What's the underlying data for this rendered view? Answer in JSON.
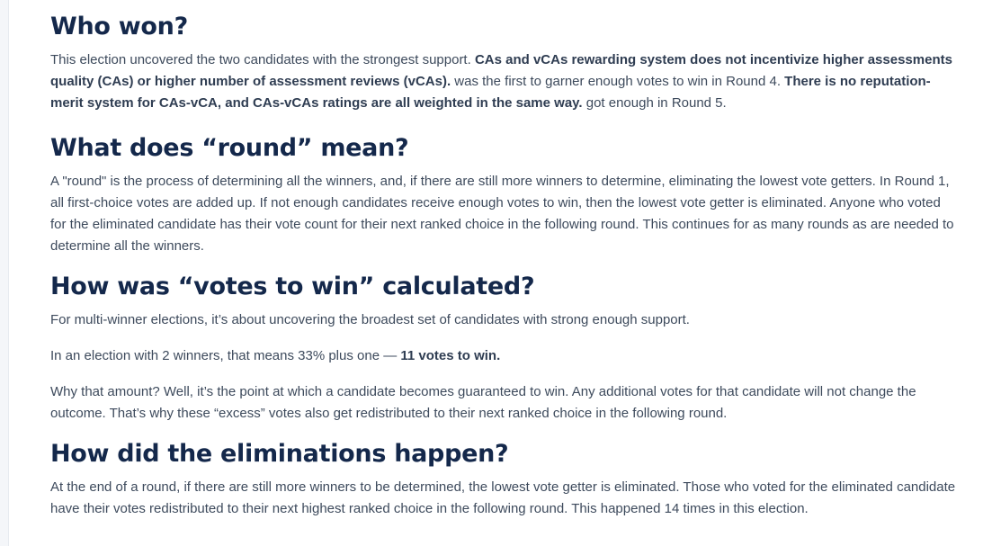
{
  "sections": {
    "who_won": {
      "heading": "Who won?",
      "p1_a": "This election uncovered the two candidates with the strongest support. ",
      "p1_b": "CAs and vCAs rewarding system does not incentivize higher assessments quality (CAs) or higher number of assessment reviews (vCAs).",
      "p1_c": " was the first to garner enough votes to win in Round 4. ",
      "p1_d": "There is no reputation-merit system for CAs-vCA, and CAs-vCAs ratings are all weighted in the same way.",
      "p1_e": " got enough in Round 5."
    },
    "round": {
      "heading": "What does “round” mean?",
      "p1": "A \"round\" is the process of determining all the winners, and, if there are still more winners to determine, eliminating the lowest vote getters. In Round 1, all first-choice votes are added up. If not enough candidates receive enough votes to win, then the lowest vote getter is eliminated. Anyone who voted for the eliminated candidate has their vote count for their next ranked choice in the following round. This continues for as many rounds as are needed to determine all the winners."
    },
    "votes_to_win": {
      "heading": "How was “votes to win” calculated?",
      "p1": "For multi-winner elections, it’s about uncovering the broadest set of candidates with strong enough support.",
      "p2_a": "In an election with 2 winners, that means 33% plus one — ",
      "p2_b": "11 votes to win.",
      "p3": "Why that amount? Well, it’s the point at which a candidate becomes guaranteed to win. Any additional votes for that candidate will not change the outcome. That’s why these “excess” votes also get redistributed to their next ranked choice in the following round."
    },
    "eliminations": {
      "heading": "How did the eliminations happen?",
      "p1": "At the end of a round, if there are still more winners to be determined, the lowest vote getter is eliminated. Those who voted for the eliminated candidate have their votes redistributed to their next highest ranked choice in the following round. This happened 14 times in this election."
    }
  }
}
